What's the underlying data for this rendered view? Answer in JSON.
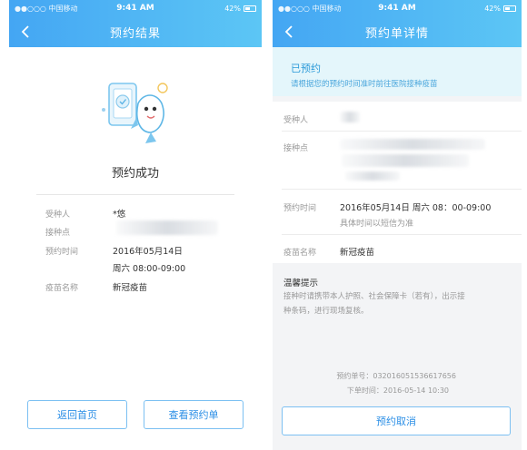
{
  "left_screen": {
    "status": {
      "carrier": "●●○○○ 中国移动",
      "time": "9:41 AM",
      "battery": "42%"
    },
    "nav": {
      "title": "预约结果"
    },
    "success_text": "预约成功",
    "fields": [
      {
        "label": "受种人",
        "value": "*悠"
      },
      {
        "label": "接种点",
        "value": ""
      },
      {
        "label": "预约时间",
        "value": "2016年05月14日"
      },
      {
        "label": "",
        "value": "周六 08:00-09:00"
      },
      {
        "label": "疫苗名称",
        "value": "新冠疫苗"
      }
    ],
    "buttons": {
      "home": "返回首页",
      "view": "查看预约单"
    }
  },
  "right_screen": {
    "status": {
      "carrier": "●●○○○ 中国移动",
      "time": "9:41 AM",
      "battery": "42%"
    },
    "nav": {
      "title": "预约单详情"
    },
    "banner": {
      "status": "已预约",
      "subtitle": "请根据您的预约时间准时前往医院接种疫苗"
    },
    "fields": {
      "recipient_label": "受种人",
      "site_label": "接种点",
      "time_label": "预约时间",
      "time_value": "2016年05月14日 周六 08：00-09:00",
      "time_note": "具体时间以短信为准",
      "vaccine_label": "疫苗名称",
      "vaccine_value": "新冠疫苗"
    },
    "tips": {
      "title": "温馨提示",
      "line1": "接种时请携带本人护照、社会保障卡（若有），出示接",
      "line2": "种条码，进行现场复核。"
    },
    "footer": {
      "order_no": "预约单号：032016051536617656",
      "order_time": "下单时间：2016-05-14 10:30"
    },
    "cancel_button": "预约取消"
  }
}
